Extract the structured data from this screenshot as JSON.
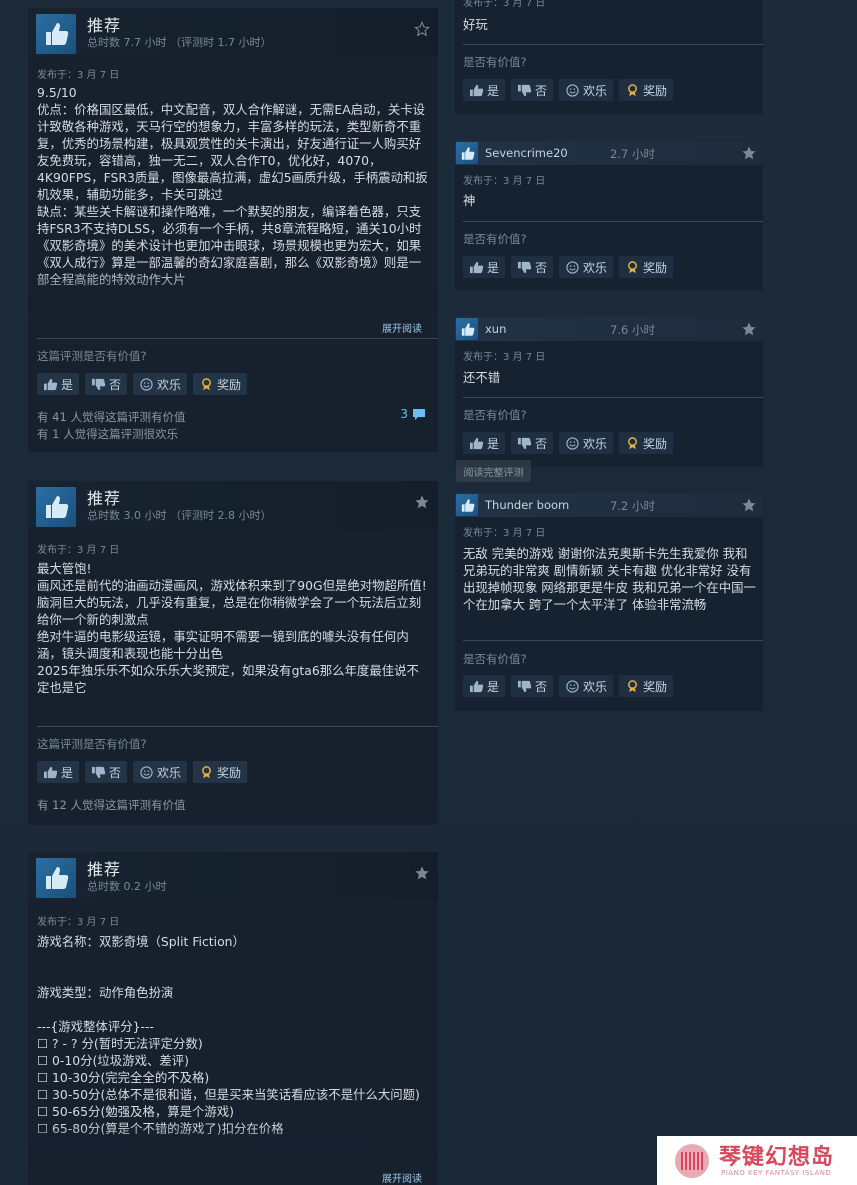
{
  "reviews_left": [
    {
      "title": "推荐",
      "hours": "总时数 7.7 小时  （评测时 1.7 小时）",
      "posted": "发布于：3 月 7 日",
      "body": "9.5/10\n优点：价格国区最低，中文配音，双人合作解谜，无需EA启动，关卡设计致敬各种游戏，天马行空的想象力，丰富多样的玩法，类型新奇不重复，优秀的场景构建，极具观赏性的关卡演出，好友通行证一人购买好友免费玩，容错高，独一无二，双人合作T0，优化好，4070，4K90FPS，FSR3质量，图像最高拉满，虚幻5画质升级，手柄震动和扳机效果，辅助功能多，卡关可跳过\n缺点：某些关卡解谜和操作略难，一个默契的朋友，编译着色器，只支持FSR3不支持DLSS，必须有一个手柄，共8章流程略短，通关10小时\n《双影奇境》的美术设计也更加冲击眼球，场景规模也更为宏大，如果《双人成行》算是一部温馨的奇幻家庭喜剧，那么《双影奇境》则是一部全程高能的特效动作大片",
      "expand": "展开阅读",
      "helpful_q": "这篇评测是否有价值?",
      "stats": [
        "有 41 人觉得这篇评测有价值",
        "有 1 人觉得这篇评测很欢乐"
      ],
      "comments": "3"
    },
    {
      "title": "推荐",
      "hours": "总时数 3.0 小时  （评测时 2.8 小时）",
      "posted": "发布于：3 月 7 日",
      "body": "最大管饱!\n画风还是前代的油画动漫画风，游戏体积来到了90G但是绝对物超所值!\n脑洞巨大的玩法，几乎没有重复，总是在你稍微学会了一个玩法后立刻给你一个新的刺激点\n绝对牛逼的电影级运镜，事实证明不需要一镜到底的噱头没有任何内涵，镜头调度和表现也能十分出色\n2025年独乐乐不如众乐乐大奖预定，如果没有gta6那么年度最佳说不定也是它",
      "helpful_q": "这篇评测是否有价值?",
      "stats": [
        "有 12 人觉得这篇评测有价值"
      ]
    },
    {
      "title": "推荐",
      "hours": "总时数 0.2 小时",
      "posted": "发布于：3 月 7 日",
      "body": "游戏名称：双影奇境（Split Fiction）\n\n\n游戏类型：动作角色扮演\n\n---{游戏整体评分}---\n☐ ? - ? 分(暂时无法评定分数)\n☐ 0-10分(垃圾游戏、差评)\n☐ 10-30分(完完全全的不及格)\n☐ 30-50分(总体不是很和谐，但是买来当笑话看应该不是什么大问题)\n☐ 50-65分(勉强及格，算是个游戏)\n☐ 65-80分(算是个不错的游戏了)扣分在价格",
      "expand": "展开阅读"
    }
  ],
  "buttons": {
    "yes": "是",
    "no": "否",
    "funny": "欢乐",
    "award": "奖励"
  },
  "reviews_right": [
    {
      "posted": "发布于：3 月 7 日",
      "body": "好玩",
      "helpful_q": "是否有价值?"
    },
    {
      "name": "Sevencrime20",
      "hours": "2.7 小时",
      "posted": "发布于：3 月 7 日",
      "body": "神",
      "helpful_q": "是否有价值?"
    },
    {
      "name": "xun",
      "hours": "7.6 小时",
      "posted": "发布于：3 月 7 日",
      "body": "还不错",
      "helpful_q": "是否有价值?"
    },
    {
      "name": "Thunder boom",
      "hours": "7.2 小时",
      "posted": "发布于：3 月 7 日",
      "body": "无敌 完美的游戏 谢谢你法克奥斯卡先生我爱你 我和兄弟玩的非常爽 剧情新颖 关卡有趣 优化非常好 没有出现掉帧现象 网络那更是牛皮 我和兄弟一个在中国一个在加拿大 跨了一个太平洋了 体验非常流畅",
      "helpful_q": "是否有价值?"
    }
  ],
  "tooltip": "阅读完整评测",
  "watermark": {
    "title": "琴键幻想岛",
    "subtitle": "PIANO KEY FANTASY ISLAND"
  },
  "colors": {
    "background": "#1b2838",
    "accent_blue": "#66c0f4",
    "award_gold": "#e7b23b",
    "watermark_red": "#d9475c"
  }
}
